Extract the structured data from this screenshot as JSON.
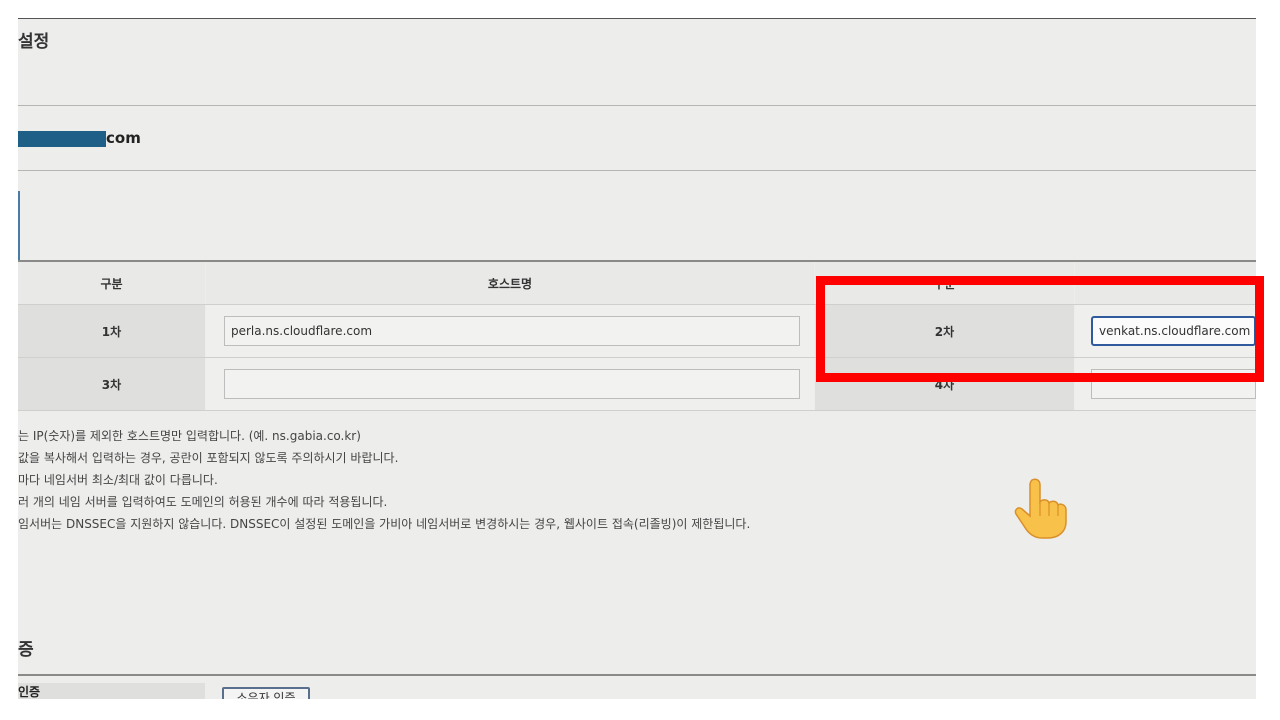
{
  "page_title": "설정",
  "domain": {
    "suffix": "com"
  },
  "nameserver_table": {
    "headers": {
      "category": "구분",
      "hostname": "호스트명",
      "category_2": "구분"
    },
    "rows": [
      {
        "label_1": "1차",
        "value_1": "perla.ns.cloudflare.com",
        "label_2": "2차",
        "value_2": "venkat.ns.cloudflare.com"
      },
      {
        "label_1": "3차",
        "value_1": "",
        "label_2": "4차",
        "value_2": ""
      }
    ]
  },
  "notes": [
    "는 IP(숫자)를 제외한 호스트명만 입력합니다. (예. ns.gabia.co.kr)",
    "값을 복사해서 입력하는 경우, 공란이 포함되지 않도록 주의하시기 바랍니다.",
    "마다 네임서버 최소/최대 값이 다릅니다.",
    "러 개의 네임 서버를 입력하여도 도메인의 허용된 개수에 따라 적용됩니다.",
    "임서버는 DNSSEC을 지원하지 않습니다. DNSSEC이 설정된 도메인을 가비아 네임서버로 변경하시는 경우, 웹사이트 접속(리졸빙)이 제한됩니다."
  ],
  "section2": {
    "title": "증",
    "row_label": "인증",
    "owner_button": "소유자 인증"
  },
  "colors": {
    "highlight": "#ff0000",
    "focus_border": "#2f5b9e",
    "redaction": "#1d5f86"
  }
}
